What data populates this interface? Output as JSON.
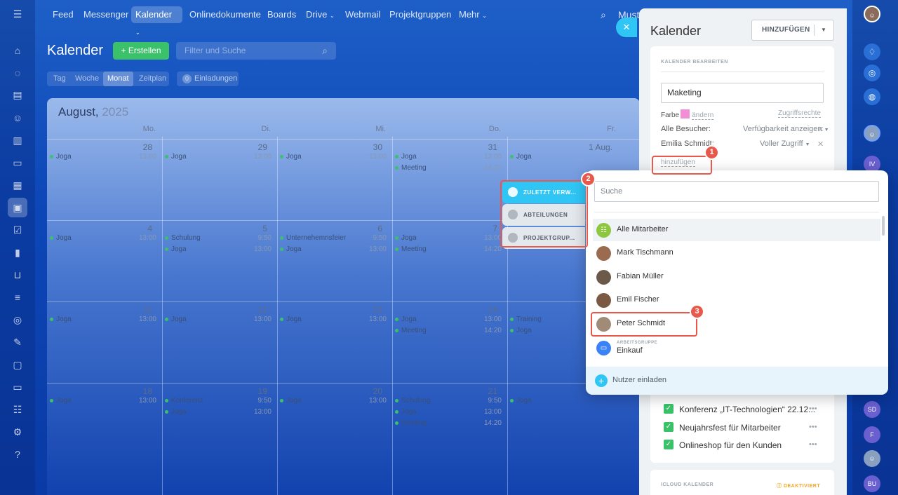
{
  "nav": {
    "items": [
      "Feed",
      "Messenger",
      "Kalender",
      "Onlinedokumente",
      "Boards",
      "Drive",
      "Webmail",
      "Projektgruppen",
      "Mehr"
    ],
    "search_prefix": "Must"
  },
  "page": {
    "title": "Kalender",
    "create_label": "+ Erstellen",
    "search_placeholder": "Filter und Suche",
    "view_tabs": [
      "Tag",
      "Woche",
      "Monat",
      "Zeitplan"
    ],
    "active_view": "Monat",
    "invitations_count": "0",
    "invitations_label": "Einladungen"
  },
  "calendar": {
    "month": "August,",
    "year": "2025",
    "day_headers": [
      "Mo.",
      "Di.",
      "Mi.",
      "Do.",
      "Fr."
    ],
    "weeks": [
      {
        "days": [
          "28",
          "29",
          "30",
          "31",
          "1 Aug."
        ],
        "events": [
          [
            {
              "t": "Joga",
              "h": "13:00"
            }
          ],
          [
            {
              "t": "Joga",
              "h": "13:00"
            }
          ],
          [
            {
              "t": "Joga",
              "h": "13:00"
            }
          ],
          [
            {
              "t": "Joga",
              "h": "13:00"
            },
            {
              "t": "Meeting",
              "h": "14:20"
            }
          ],
          [
            {
              "t": "Joga",
              "h": ""
            }
          ]
        ]
      },
      {
        "days": [
          "4",
          "5",
          "6",
          "7",
          "8"
        ],
        "events": [
          [
            {
              "t": "Joga",
              "h": "13:00"
            }
          ],
          [
            {
              "t": "Schulung",
              "h": "9:50"
            },
            {
              "t": "Joga",
              "h": "13:00"
            }
          ],
          [
            {
              "t": "Unternehemnsfeier",
              "h": "9:50"
            },
            {
              "t": "Joga",
              "h": "13:00"
            }
          ],
          [
            {
              "t": "Joga",
              "h": "13:00"
            },
            {
              "t": "Meeting",
              "h": "14:20"
            }
          ],
          [
            {
              "t": "Joga",
              "h": ""
            }
          ]
        ]
      },
      {
        "days": [
          "11",
          "12",
          "13",
          "14",
          "15"
        ],
        "events": [
          [
            {
              "t": "Joga",
              "h": "13:00"
            }
          ],
          [
            {
              "t": "Joga",
              "h": "13:00"
            }
          ],
          [
            {
              "t": "Joga",
              "h": "13:00"
            }
          ],
          [
            {
              "t": "Joga",
              "h": "13:00"
            },
            {
              "t": "Meeting",
              "h": "14:20"
            }
          ],
          [
            {
              "t": "Training",
              "h": ""
            },
            {
              "t": "Joga",
              "h": ""
            }
          ]
        ]
      },
      {
        "days": [
          "18",
          "19",
          "20",
          "21",
          "22"
        ],
        "events": [
          [
            {
              "t": "Joga",
              "h": "13:00"
            }
          ],
          [
            {
              "t": "Konferenz",
              "h": "9:50"
            },
            {
              "t": "Joga",
              "h": "13:00"
            }
          ],
          [
            {
              "t": "Joga",
              "h": "13:00"
            }
          ],
          [
            {
              "t": "Schulung",
              "h": "9:50"
            },
            {
              "t": "Joga",
              "h": "13:00"
            },
            {
              "t": "Meeting",
              "h": "14:20"
            }
          ],
          [
            {
              "t": "Joga",
              "h": ""
            }
          ]
        ]
      }
    ]
  },
  "panel": {
    "title": "Kalender",
    "add_button": "HINZUFÜGEN",
    "section_edit": "KALENDER BEARBEITEN",
    "calendar_name": "Maketing",
    "color_label": "Farbe",
    "color_value": "#f08fd4",
    "change_link": "ändern",
    "access_link": "Zugriffsrechte",
    "rights": [
      {
        "who": "Alle Besucher:",
        "level": "Verfügbarkeit anzeigen"
      },
      {
        "who": "Emilia Schmidt:",
        "level": "Voller Zugriff"
      }
    ],
    "add_link": "hinzufügen",
    "checklist": [
      "Konferenz „IT-Technologien“ 22.12...",
      "Neujahrsfest für Mitarbeiter",
      "Onlineshop für den Kunden"
    ],
    "icloud_label": "ICLOUD KALENDER",
    "icloud_status": "DEAKTIVIERT"
  },
  "popup": {
    "tabs": [
      "ZULETZT VERW...",
      "ABTEILUNGEN",
      "PROJEKTGRUP..."
    ],
    "search_placeholder": "Suche",
    "items": [
      {
        "name": "Alle Mitarbeiter",
        "sub": ""
      },
      {
        "name": "Mark Tischmann",
        "sub": ""
      },
      {
        "name": "Fabian Müller",
        "sub": ""
      },
      {
        "name": "Emil Fischer",
        "sub": ""
      },
      {
        "name": "Peter Schmidt",
        "sub": ""
      },
      {
        "name": "Einkauf",
        "sub": "ARBEITSGRUPPE"
      }
    ],
    "invite_label": "Nutzer einladen"
  },
  "annotations": {
    "badges": [
      "1",
      "2",
      "3"
    ]
  },
  "rightrail": {
    "avatars": [
      "IV",
      "SD",
      "F",
      "BU"
    ]
  },
  "colors": {
    "accent": "#2fc6f6",
    "create": "#3bc16a",
    "highlight": "#e8584b"
  }
}
